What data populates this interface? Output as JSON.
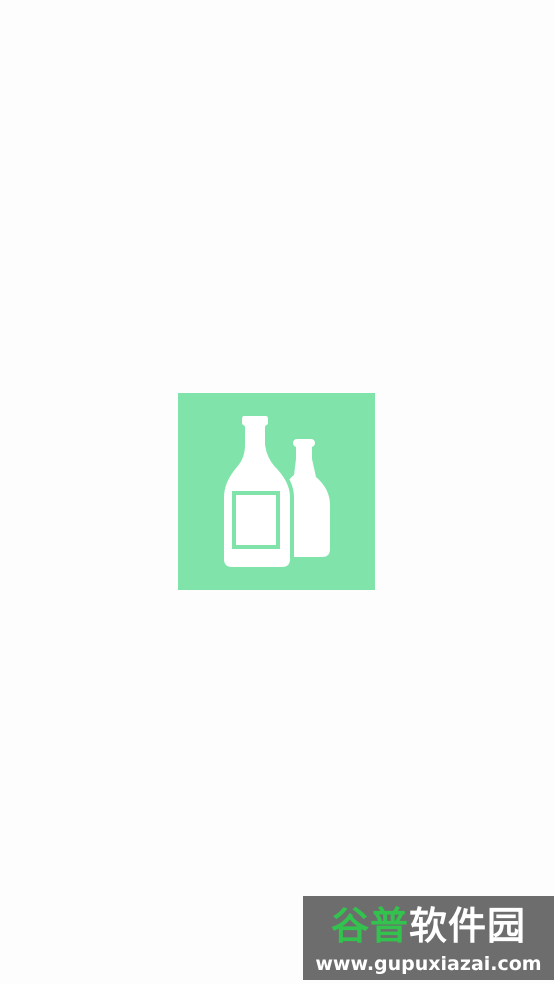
{
  "splash": {
    "logo_icon": "bottles-icon",
    "logo_background_color": "#80e4aa",
    "logo_foreground_color": "#ffffff"
  },
  "watermark": {
    "brand_part1": "谷普",
    "brand_part2": "软件园",
    "url": "www.gupuxiazai.com",
    "accent_color": "#33c24d",
    "background_color": "#6d6d6d"
  }
}
